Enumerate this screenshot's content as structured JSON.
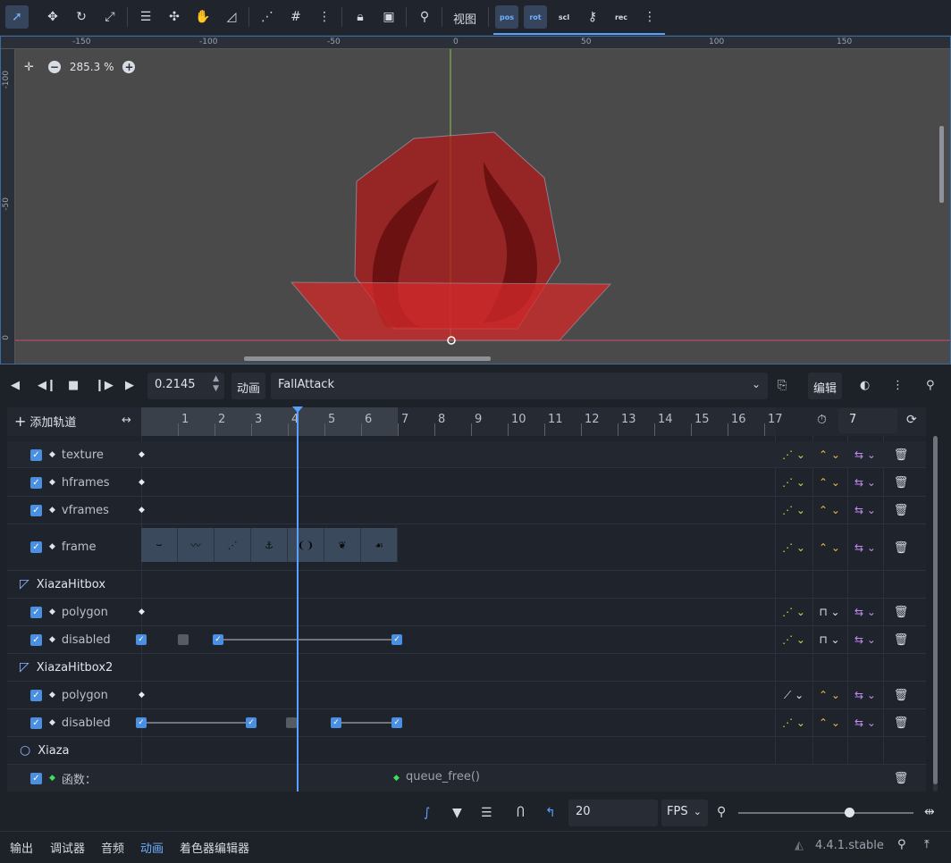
{
  "toolbar": {
    "view_label": "视图",
    "pos_label": "pos",
    "rot_label": "rot",
    "scl_label": "scl",
    "rec_label": "rec"
  },
  "viewport": {
    "zoom_label": "285.3 %",
    "ruler_top_labels": [
      "-150",
      "-100",
      "-50",
      "0",
      "50",
      "100",
      "150"
    ],
    "ruler_left_labels": [
      "-100",
      "-50",
      "0"
    ]
  },
  "anim_toolbar": {
    "time_value": "0.2145",
    "anim_button": "动画",
    "animation_name": "FallAttack",
    "edit_button": "编辑"
  },
  "track_header": {
    "add_track_label": "添加轨道",
    "frame_numbers": [
      "1",
      "2",
      "3",
      "4",
      "5",
      "6",
      "7",
      "8",
      "9",
      "10",
      "11",
      "12",
      "13",
      "14",
      "15",
      "16",
      "17"
    ],
    "length_value": "7"
  },
  "tracks": [
    {
      "type": "prop",
      "name": "texture"
    },
    {
      "type": "prop",
      "name": "hframes"
    },
    {
      "type": "prop",
      "name": "vframes"
    },
    {
      "type": "prop",
      "name": "frame"
    },
    {
      "type": "node",
      "name": "XiazaHitbox"
    },
    {
      "type": "prop",
      "name": "polygon"
    },
    {
      "type": "prop",
      "name": "disabled"
    },
    {
      "type": "node",
      "name": "XiazaHitbox2"
    },
    {
      "type": "prop",
      "name": "polygon"
    },
    {
      "type": "prop",
      "name": "disabled"
    },
    {
      "type": "node",
      "name": "Xiaza"
    },
    {
      "type": "method",
      "name": "函数：",
      "key_label": "queue_free()"
    }
  ],
  "bottom_tools": {
    "fps_value": "20",
    "fps_unit": "FPS"
  },
  "statusbar": {
    "tabs": [
      "输出",
      "调试器",
      "音频",
      "动画",
      "着色器编辑器"
    ],
    "active_tab": "动画",
    "version": "4.4.1.stable"
  },
  "colors": {
    "accent": "#5aa0ff",
    "viewport_bg": "#4a4a4a",
    "hitbox_red": "#c02020"
  }
}
